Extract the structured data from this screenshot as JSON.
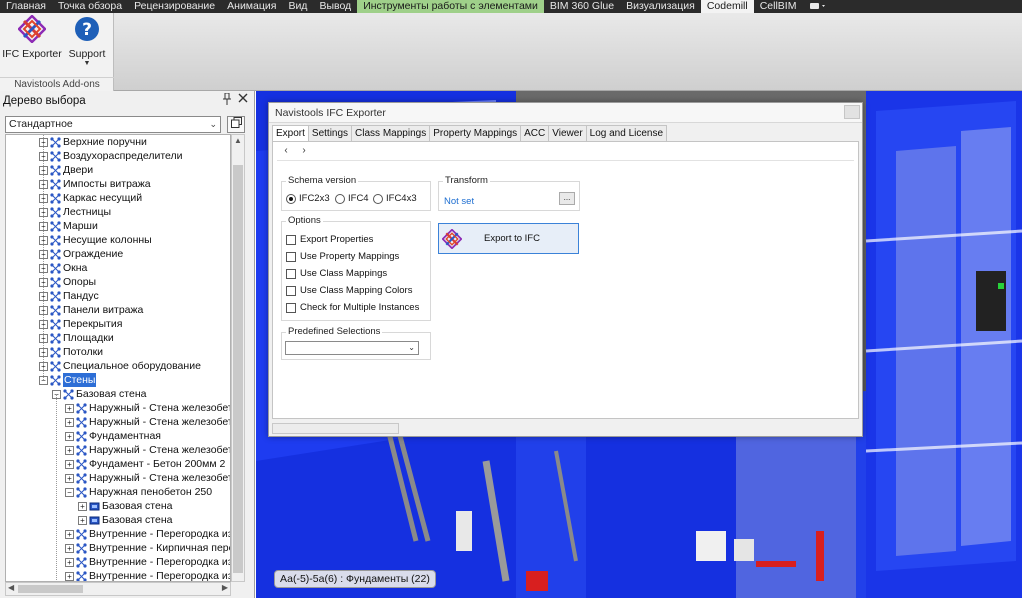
{
  "ribbon_tabs": [
    {
      "label": "Главная",
      "state": "normal"
    },
    {
      "label": "Точка обзора",
      "state": "normal"
    },
    {
      "label": "Рецензирование",
      "state": "normal"
    },
    {
      "label": "Анимация",
      "state": "normal"
    },
    {
      "label": "Вид",
      "state": "normal"
    },
    {
      "label": "Вывод",
      "state": "normal"
    },
    {
      "label": "Инструменты работы с элементами",
      "state": "green"
    },
    {
      "label": "BIM 360 Glue",
      "state": "normal"
    },
    {
      "label": "Визуализация",
      "state": "normal"
    },
    {
      "label": "Codemill",
      "state": "active"
    },
    {
      "label": "CellBIM",
      "state": "normal"
    }
  ],
  "ribbon": {
    "group_label": "Navistools Add-ons",
    "ifc_exporter_label": "IFC Exporter",
    "support_label": "Support"
  },
  "tree_panel": {
    "title": "Дерево выбора",
    "combo_value": "Стандартное",
    "rows": [
      {
        "label": "Верхние поручни",
        "level": 0,
        "expander": "+"
      },
      {
        "label": "Воздухораспределители",
        "level": 0,
        "expander": "+"
      },
      {
        "label": "Двери",
        "level": 0,
        "expander": "+"
      },
      {
        "label": "Импосты витража",
        "level": 0,
        "expander": "+"
      },
      {
        "label": "Каркас несущий",
        "level": 0,
        "expander": "+"
      },
      {
        "label": "Лестницы",
        "level": 0,
        "expander": "+"
      },
      {
        "label": "Марши",
        "level": 0,
        "expander": "+"
      },
      {
        "label": "Несущие колонны",
        "level": 0,
        "expander": "+"
      },
      {
        "label": "Ограждение",
        "level": 0,
        "expander": "+"
      },
      {
        "label": "Окна",
        "level": 0,
        "expander": "+"
      },
      {
        "label": "Опоры",
        "level": 0,
        "expander": "+"
      },
      {
        "label": "Пандус",
        "level": 0,
        "expander": "+"
      },
      {
        "label": "Панели витража",
        "level": 0,
        "expander": "+"
      },
      {
        "label": "Перекрытия",
        "level": 0,
        "expander": "+"
      },
      {
        "label": "Площадки",
        "level": 0,
        "expander": "+"
      },
      {
        "label": "Потолки",
        "level": 0,
        "expander": "+"
      },
      {
        "label": "Специальное оборудование",
        "level": 0,
        "expander": "+"
      },
      {
        "label": "Стены",
        "level": 0,
        "expander": "-",
        "selected": true
      },
      {
        "label": "Базовая стена",
        "level": 1,
        "expander": "-"
      },
      {
        "label": "Наружный - Стена железобетонн",
        "level": 2,
        "expander": "+"
      },
      {
        "label": "Наружный - Стена железобетонн",
        "level": 2,
        "expander": "+"
      },
      {
        "label": "Фундаментная",
        "level": 2,
        "expander": "+"
      },
      {
        "label": "Наружный - Стена железобетонн",
        "level": 2,
        "expander": "+"
      },
      {
        "label": "Фундамент - Бетон 200мм 2",
        "level": 2,
        "expander": "+"
      },
      {
        "label": "Наружный - Стена железобетонн",
        "level": 2,
        "expander": "+"
      },
      {
        "label": "Наружная пенобетон 250",
        "level": 2,
        "expander": "-"
      },
      {
        "label": "Базовая стена",
        "level": 3,
        "expander": "+",
        "icon": "block"
      },
      {
        "label": "Базовая стена",
        "level": 3,
        "expander": "+",
        "icon": "block"
      },
      {
        "label": "Внутренние - Перегородка из пе",
        "level": 2,
        "expander": "+"
      },
      {
        "label": "Внутренние - Кирпичная перего",
        "level": 2,
        "expander": "+"
      },
      {
        "label": "Внутренние - Перегородка из пе",
        "level": 2,
        "expander": "+"
      },
      {
        "label": "Внутренние - Перегородка из пе",
        "level": 2,
        "expander": "+"
      }
    ]
  },
  "dialog": {
    "title": "Navistools IFC Exporter",
    "tabs": [
      "Export",
      "Settings",
      "Class Mappings",
      "Property Mappings",
      "ACC",
      "Viewer",
      "Log and License"
    ],
    "active_tab": "Export",
    "schema_version": {
      "title": "Schema version",
      "options": [
        "IFC2x3",
        "IFC4",
        "IFC4x3"
      ],
      "selected": "IFC2x3"
    },
    "transform": {
      "title": "Transform",
      "value": "Not set",
      "button_label": "..."
    },
    "options": {
      "title": "Options",
      "items": [
        {
          "label": "Export Properties",
          "checked": false
        },
        {
          "label": "Use Property Mappings",
          "checked": false
        },
        {
          "label": "Use Class Mappings",
          "checked": false
        },
        {
          "label": "Use Class Mapping Colors",
          "checked": false
        },
        {
          "label": "Check for Multiple Instances",
          "checked": false
        }
      ]
    },
    "predefined": {
      "title": "Predefined Selections",
      "value": ""
    },
    "export_button_label": "Export to IFC"
  },
  "viewport": {
    "status_text": "Аа(-5)-5а(6) : Фундаменты (22)"
  },
  "colors": {
    "selection": "#2d6ed6",
    "tab_highlight": "#9fd08a",
    "model_blue": "#1530e0"
  }
}
